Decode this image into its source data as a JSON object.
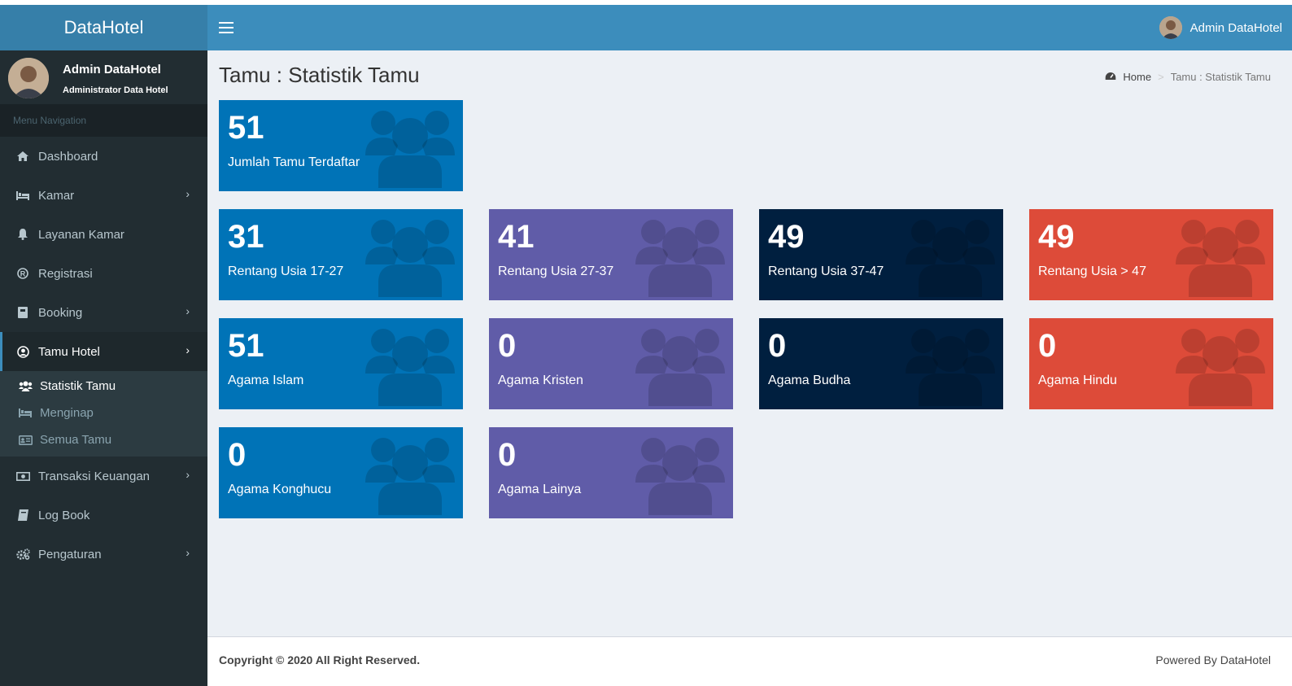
{
  "brand": "DataHotel",
  "header": {
    "user_name": "Admin DataHotel"
  },
  "sidebar": {
    "user_name": "Admin DataHotel",
    "user_role": "Administrator Data Hotel",
    "menu_header": "Menu Navigation",
    "items": [
      {
        "label": "Dashboard",
        "icon": "home-icon"
      },
      {
        "label": "Kamar",
        "icon": "bed-icon"
      },
      {
        "label": "Layanan Kamar",
        "icon": "bell-icon"
      },
      {
        "label": "Registrasi",
        "icon": "registered-icon"
      },
      {
        "label": "Booking",
        "icon": "book-icon"
      },
      {
        "label": "Tamu Hotel",
        "icon": "user-circle-icon"
      },
      {
        "label": "Transaksi Keuangan",
        "icon": "money-icon"
      },
      {
        "label": "Log Book",
        "icon": "book-icon"
      },
      {
        "label": "Pengaturan",
        "icon": "cogs-icon"
      }
    ],
    "sub_items": [
      {
        "label": "Statistik Tamu",
        "icon": "users-icon"
      },
      {
        "label": "Menginap",
        "icon": "bed-icon"
      },
      {
        "label": "Semua Tamu",
        "icon": "id-card-icon"
      }
    ]
  },
  "page": {
    "title": "Tamu : Statistik Tamu",
    "breadcrumb_home": "Home",
    "breadcrumb_current": "Tamu : Statistik Tamu"
  },
  "boxes": [
    {
      "value": "51",
      "label": "Jumlah Tamu Terdaftar",
      "color": "#0073b7"
    },
    {
      "value": "31",
      "label": "Rentang Usia 17-27",
      "color": "#0073b7"
    },
    {
      "value": "41",
      "label": "Rentang Usia 27-37",
      "color": "#605ca8"
    },
    {
      "value": "49",
      "label": "Rentang Usia 37-47",
      "color": "#001f3f"
    },
    {
      "value": "49",
      "label": "Rentang Usia > 47",
      "color": "#dd4b39"
    },
    {
      "value": "51",
      "label": "Agama Islam",
      "color": "#0073b7"
    },
    {
      "value": "0",
      "label": "Agama Kristen",
      "color": "#605ca8"
    },
    {
      "value": "0",
      "label": "Agama Budha",
      "color": "#001f3f"
    },
    {
      "value": "0",
      "label": "Agama Hindu",
      "color": "#dd4b39"
    },
    {
      "value": "0",
      "label": "Agama Konghucu",
      "color": "#0073b7"
    },
    {
      "value": "0",
      "label": "Agama Lainya",
      "color": "#605ca8"
    }
  ],
  "footer": {
    "copyright": "Copyright © 2020 All Right Reserved.",
    "powered": "Powered By DataHotel"
  }
}
